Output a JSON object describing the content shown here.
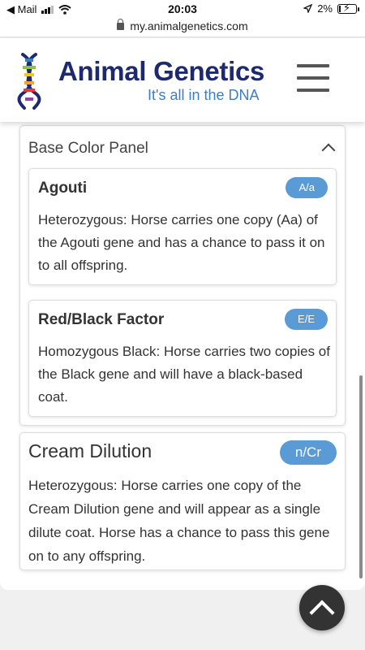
{
  "status_bar": {
    "back_app": "◀ Mail",
    "time": "20:03",
    "battery": "2%",
    "battery_level": 0.02,
    "icons": [
      "signal-icon",
      "wifi-icon",
      "location-arrow-icon",
      "battery-charging-icon"
    ]
  },
  "url_bar": {
    "url": "my.animalgenetics.com",
    "icon": "lock-icon"
  },
  "header": {
    "brand_name": "Animal Genetics",
    "tagline": "It's all in the DNA",
    "menu_icon": "hamburger-menu-icon",
    "brand_colors": {
      "name": "#1e2a6e",
      "tagline": "#3a7fc6"
    }
  },
  "panel": {
    "title": "Base Color Panel",
    "toggle_icon": "chevron-up-icon",
    "cards": [
      {
        "title": "Agouti",
        "badge": "A/a",
        "text": "Heterozygous: Horse carries one copy (Aa) of the Agouti gene and has a chance to pass it on to all offspring."
      },
      {
        "title": "Red/Black Factor",
        "badge": "E/E",
        "text": "Homozygous Black: Horse carries two copies of the Black gene and will have a black-based coat."
      }
    ]
  },
  "cream": {
    "title": "Cream Dilution",
    "badge": "n/Cr",
    "text": "Heterozygous: Horse carries one copy of the Cream Dilution gene and will appear as a single dilute coat. Horse has a chance to pass this gene on to any offspring."
  },
  "scroll_top_icon": "chevron-up-icon",
  "accent_color": "#5b9bd5"
}
